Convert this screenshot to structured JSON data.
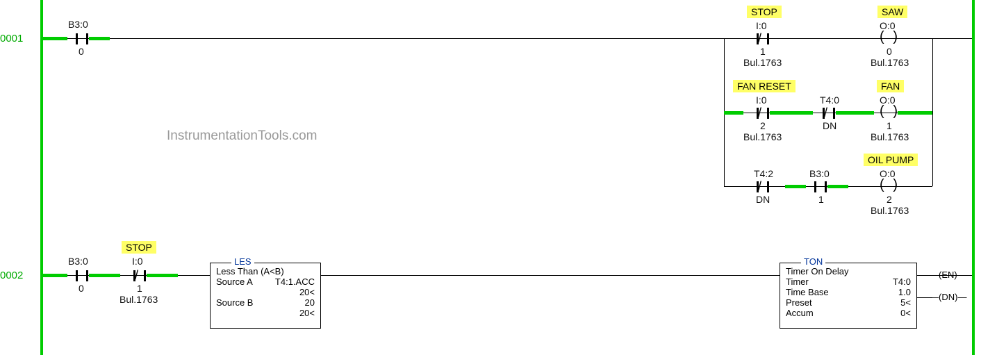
{
  "watermark": "InstrumentationTools.com",
  "rung1": {
    "number": "0001",
    "xic_b30": {
      "addr_top": "B3:0",
      "addr_bot": "0"
    },
    "branch1": {
      "stop": {
        "tag": "STOP",
        "addr_top": "I:0",
        "addr_bot": "1",
        "bul": "Bul.1763"
      },
      "saw": {
        "tag": "SAW",
        "addr_top": "O:0",
        "addr_bot": "0",
        "bul": "Bul.1763"
      }
    },
    "branch2": {
      "fanreset": {
        "tag": "FAN RESET",
        "addr_top": "I:0",
        "addr_bot": "2",
        "bul": "Bul.1763"
      },
      "t40": {
        "addr_top": "T4:0",
        "addr_bot": "DN"
      },
      "fan": {
        "tag": "FAN",
        "addr_top": "O:0",
        "addr_bot": "1",
        "bul": "Bul.1763"
      }
    },
    "branch3": {
      "t42": {
        "addr_top": "T4:2",
        "addr_bot": "DN"
      },
      "b30": {
        "addr_top": "B3:0",
        "addr_bot": "1"
      },
      "oil": {
        "tag": "OIL PUMP",
        "addr_top": "O:0",
        "addr_bot": "2",
        "bul": "Bul.1763"
      }
    }
  },
  "rung2": {
    "number": "0002",
    "xic_b30": {
      "addr_top": "B3:0",
      "addr_bot": "0"
    },
    "stop": {
      "tag": "STOP",
      "addr_top": "I:0",
      "addr_bot": "1",
      "bul": "Bul.1763"
    },
    "les": {
      "title": "LES",
      "desc": "Less Than (A<B)",
      "srcA_label": "Source A",
      "srcA_val": "T4:1.ACC",
      "srcA_sub": "20<",
      "srcB_label": "Source B",
      "srcB_val": "20",
      "srcB_sub": "20<"
    },
    "ton": {
      "title": "TON",
      "desc": "Timer On Delay",
      "rows": [
        {
          "k": "Timer",
          "v": "T4:0"
        },
        {
          "k": "Time Base",
          "v": "1.0"
        },
        {
          "k": "Preset",
          "v": "5<"
        },
        {
          "k": "Accum",
          "v": "0<"
        }
      ],
      "flags": {
        "en": "EN",
        "dn": "DN"
      }
    }
  }
}
